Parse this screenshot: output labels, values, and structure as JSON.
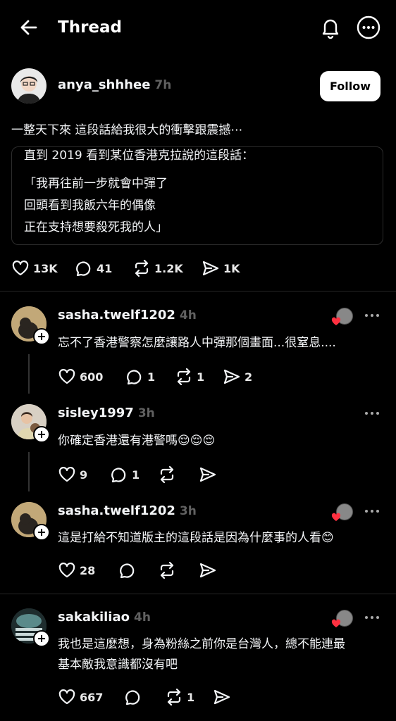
{
  "header": {
    "title": "Thread"
  },
  "post": {
    "username": "anya_shhhee",
    "time": "7h",
    "follow_label": "Follow",
    "text": "一整天下來 這段話給我很大的衝擊跟震撼⋯",
    "quote_lines": [
      "直到 2019 看到某位香港克拉說的這段話：",
      "「我再往前一步就會中彈了",
      "回頭看到我飯六年的偶像",
      "正在支持想要殺死我的人」"
    ],
    "likes": "13K",
    "replies": "41",
    "reposts": "1.2K",
    "shares": "1K"
  },
  "comments": [
    {
      "username": "sasha.twelf1202",
      "time": "4h",
      "text": "忘不了香港警察怎麼讓路人中彈那個畫面...很窒息....",
      "likes": "600",
      "replies": "1",
      "reposts": "1",
      "shares": "2"
    },
    {
      "username": "sisley1997",
      "time": "3h",
      "text": "你確定香港還有港警嗎",
      "emojis": "😌😌😌",
      "likes": "9",
      "replies": "1"
    },
    {
      "username": "sasha.twelf1202",
      "time": "3h",
      "text": "這是打給不知道版主的這段話是因為什麼事的人看",
      "emojis": "😊",
      "likes": "28"
    },
    {
      "username": "sakakiliao",
      "time": "4h",
      "text_line1": "我也是這麼想，身為粉絲之前你是台灣人，總不能連最",
      "text_line2": "基本敵我意識都沒有吧",
      "likes": "667",
      "reposts": "1"
    }
  ]
}
